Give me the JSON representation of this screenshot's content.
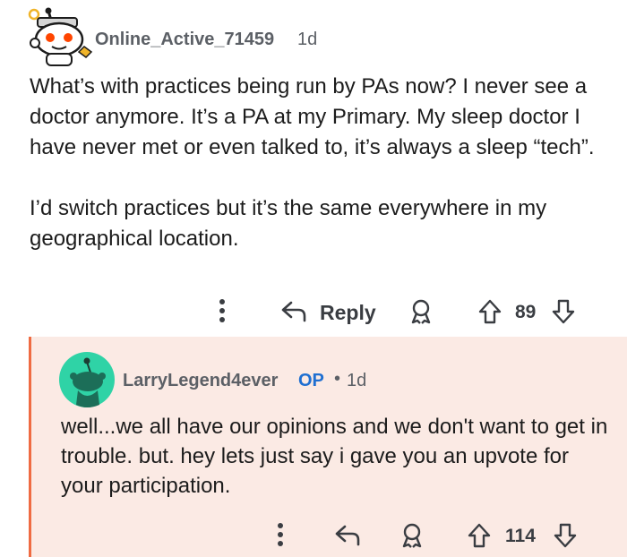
{
  "comment": {
    "username": "Online_Active_71459",
    "age": "1d",
    "paragraphs": [
      "What’s with practices being run by PAs now? I never see a doctor anymore. It’s a PA at my Primary. My sleep doctor I have never met or even talked to, it’s always a sleep “tech”.",
      "I’d switch practices but it’s the same everywhere in my geographical location."
    ],
    "actions": {
      "reply_label": "Reply",
      "vote_count": "89"
    }
  },
  "reply": {
    "username": "LarryLegend4ever",
    "op_badge": "OP",
    "separator": "•",
    "age": "1d",
    "body": "well...we all have our opinions and we don't want to get in trouble. but. hey lets just say i gave you an upvote for your participation.",
    "actions": {
      "vote_count": "114"
    }
  },
  "colors": {
    "accent": "#ef6b42",
    "reply_background": "#fbeae4",
    "op_blue": "#1f6fd1",
    "avatar_teal": "#2fd3a6"
  },
  "icons": [
    "reddit-snoo-avatar-icon",
    "more-options-icon",
    "reply-arrow-icon",
    "award-icon",
    "upvote-arrow-icon",
    "downvote-arrow-icon"
  ]
}
